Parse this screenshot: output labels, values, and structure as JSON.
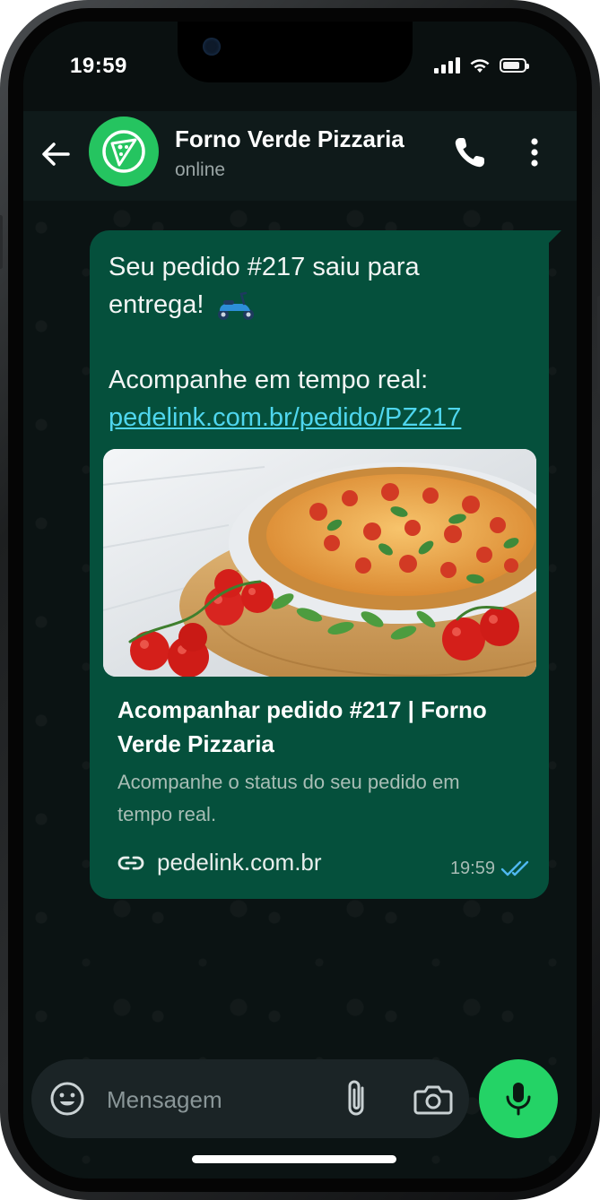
{
  "status_bar": {
    "time": "19:59"
  },
  "header": {
    "contact_name": "Forno Verde Pizzaria",
    "contact_status": "online"
  },
  "message": {
    "line1": "Seu pedido #217 saiu para",
    "line2": "entrega!",
    "line4": "Acompanhe em tempo real:",
    "link": "pedelink.com.br/pedido/PZ217",
    "preview": {
      "title": "Acompanhar pedido #217 | Forno Verde Pizzaria",
      "description": "Acompanhe o status do seu pedido em tempo real.",
      "domain": "pedelink.com.br"
    },
    "time": "19:59"
  },
  "input_bar": {
    "placeholder": "Mensagem"
  },
  "colors": {
    "accent_green": "#24d366",
    "bubble_bg": "#05503c",
    "link": "#4fd6ee",
    "read_ticks": "#4fb8f0"
  },
  "icons": [
    "back-arrow-icon",
    "pizza-logo-icon",
    "phone-icon",
    "more-vertical-icon",
    "scooter-icon",
    "link-icon",
    "double-check-icon",
    "emoji-icon",
    "paperclip-icon",
    "camera-icon",
    "mic-icon"
  ]
}
